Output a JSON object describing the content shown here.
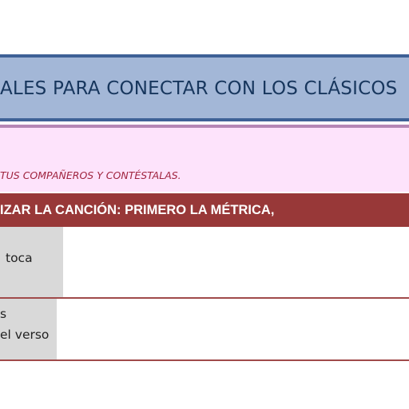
{
  "header": {
    "title": "ALES PARA CONECTAR CON LOS CLÁSICOS"
  },
  "instructions": {
    "text": "TUS COMPAÑEROS Y CONTÉSTALAS."
  },
  "section": {
    "heading": "IZAR LA CANCIÓN: PRIMERO LA MÉTRICA,"
  },
  "table": {
    "rows": [
      {
        "label_lines": [
          "toca"
        ],
        "answer": ""
      },
      {
        "label_lines": [
          "s",
          "el verso"
        ],
        "answer": ""
      }
    ]
  },
  "colors": {
    "title_band": "#a3b7d7",
    "title_border": "#3e6196",
    "pink_band": "#fde3fb",
    "red_band": "#983838",
    "label_cell": "#d9d9d9"
  }
}
